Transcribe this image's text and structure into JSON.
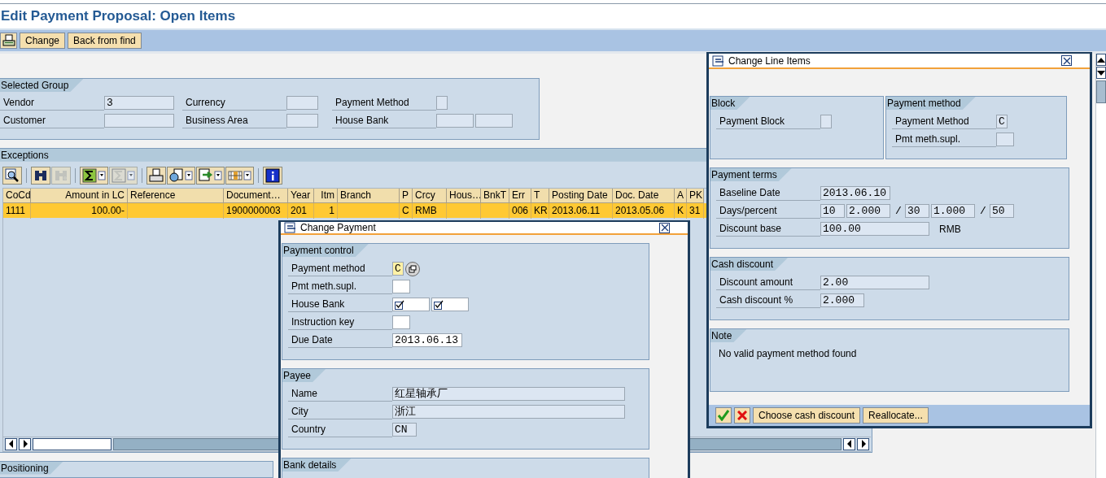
{
  "title": "Edit Payment Proposal: Open Items",
  "toolbar": {
    "buttons": [
      "Change",
      "Back from find"
    ]
  },
  "selected_group": {
    "title": "Selected Group",
    "fields": [
      {
        "label": "Vendor",
        "boxes": [
          {
            "editable": false,
            "value": "3"
          }
        ]
      },
      {
        "label": "Currency",
        "boxes": [
          {
            "editable": false
          }
        ]
      },
      {
        "label": "Payment Method",
        "boxes": [
          {
            "editable": false
          }
        ]
      },
      {
        "label": "Customer",
        "boxes": [
          {
            "editable": false
          }
        ]
      },
      {
        "label": "Business Area",
        "boxes": [
          {
            "editable": false
          }
        ]
      },
      {
        "label": "House Bank",
        "boxes": [
          {
            "editable": false
          },
          {
            "editable": false
          }
        ]
      }
    ]
  },
  "exceptions": {
    "title": "Exceptions",
    "tools": [
      {
        "kind": "details",
        "disabled": false
      },
      {
        "kind": "find",
        "disabled": false
      },
      {
        "kind": "find-next",
        "disabled": true
      },
      {
        "kind": "sum",
        "disabled": false
      },
      {
        "kind": "subtotal",
        "disabled": true
      },
      {
        "kind": "print",
        "disabled": false
      },
      {
        "kind": "view",
        "disabled": false
      },
      {
        "kind": "export",
        "disabled": false
      },
      {
        "kind": "layout",
        "disabled": false
      },
      {
        "kind": "info",
        "disabled": false
      }
    ],
    "columns": [
      "CoCd",
      "Amount in LC",
      "Reference",
      "Document…",
      "Year",
      "Itm",
      "Branch",
      "P",
      "Crcy",
      "Hous…",
      "BnkT",
      "Err",
      "T",
      "Posting Date",
      "Doc. Date",
      "A",
      "PK"
    ],
    "rows": [
      {
        "selected": true,
        "cells": [
          "1111",
          "100.00-",
          null,
          "1900000003",
          "201",
          "1",
          null,
          "C",
          "RMB",
          null,
          null,
          "006",
          "KR",
          "2013.06.11",
          "2013.05.06",
          "K",
          "31"
        ]
      }
    ]
  },
  "positioning": {
    "title": "Positioning"
  },
  "dialogs": [
    {
      "title": "Change Payment",
      "groups": [
        {
          "title": "Payment control",
          "fields": [
            {
              "label": "Payment method",
              "boxes": [
                {
                  "kind": "field",
                  "editable": true,
                  "focused": true,
                  "value": "C"
                },
                {
                  "kind": "help"
                }
              ]
            },
            {
              "label": "Pmt meth.supl.",
              "boxes": [
                {
                  "kind": "field",
                  "editable": true,
                  "focused": false
                }
              ]
            },
            {
              "label": "House Bank",
              "boxes": [
                {
                  "kind": "required",
                  "editable": true,
                  "focused": false
                },
                {
                  "kind": "required",
                  "editable": true,
                  "focused": false
                }
              ]
            },
            {
              "label": "Instruction key",
              "boxes": [
                {
                  "kind": "field",
                  "editable": true,
                  "focused": false
                }
              ]
            },
            {
              "label": "Due Date",
              "boxes": [
                {
                  "kind": "field",
                  "editable": true,
                  "focused": false,
                  "value": "2013.06.13"
                }
              ]
            }
          ]
        },
        {
          "title": "Payee",
          "fields": [
            {
              "label": "Name",
              "boxes": [
                {
                  "kind": "field",
                  "editable": false,
                  "focused": false,
                  "value": "红星轴承厂"
                }
              ]
            },
            {
              "label": "City",
              "boxes": [
                {
                  "kind": "field",
                  "editable": false,
                  "focused": false,
                  "value": "浙江"
                }
              ]
            },
            {
              "label": "Country",
              "boxes": [
                {
                  "kind": "field",
                  "editable": false,
                  "focused": false,
                  "value": "CN"
                }
              ]
            }
          ]
        },
        {
          "title": "Bank details"
        }
      ]
    },
    {
      "title": "Change Line Items",
      "groups": [
        {
          "title": "Block",
          "fields": [
            {
              "label": "Payment Block",
              "boxes": [
                {
                  "kind": "field",
                  "editable": false,
                  "focused": false
                }
              ]
            }
          ]
        },
        {
          "title": "Payment method",
          "fields": [
            {
              "label": "Payment Method",
              "boxes": [
                {
                  "kind": "field",
                  "editable": false,
                  "focused": false,
                  "value": "C"
                }
              ]
            },
            {
              "label": "Pmt meth.supl.",
              "boxes": [
                {
                  "kind": "field",
                  "editable": false,
                  "focused": false
                }
              ]
            }
          ]
        },
        {
          "title": "Payment terms",
          "fields": [
            {
              "label": "Baseline Date",
              "boxes": [
                {
                  "kind": "field",
                  "editable": false,
                  "focused": false,
                  "value": "2013.06.10"
                }
              ]
            },
            {
              "label": "Days/percent",
              "boxes": [
                {
                  "kind": "field",
                  "editable": false,
                  "focused": false,
                  "value": "10"
                },
                {
                  "kind": "field",
                  "editable": false,
                  "focused": false,
                  "value": "2.000"
                },
                {
                  "kind": "sep",
                  "value": "/"
                },
                {
                  "kind": "field",
                  "editable": false,
                  "focused": false,
                  "value": "30"
                },
                {
                  "kind": "field",
                  "editable": false,
                  "focused": false,
                  "value": "1.000"
                },
                {
                  "kind": "sep",
                  "value": "/"
                },
                {
                  "kind": "field",
                  "editable": false,
                  "focused": false,
                  "value": "50"
                }
              ]
            },
            {
              "label": "Discount base",
              "boxes": [
                {
                  "kind": "field",
                  "editable": false,
                  "focused": false,
                  "value": "100.00"
                },
                {
                  "kind": "unit",
                  "value": "RMB"
                }
              ]
            }
          ]
        },
        {
          "title": "Cash discount",
          "fields": [
            {
              "label": "Discount amount",
              "boxes": [
                {
                  "kind": "field",
                  "editable": false,
                  "focused": false,
                  "value": "2.00"
                }
              ]
            },
            {
              "label": "Cash discount %",
              "boxes": [
                {
                  "kind": "field",
                  "editable": false,
                  "focused": false,
                  "value": "2.000"
                }
              ]
            }
          ]
        },
        {
          "title": "Note",
          "text": "No valid payment method found"
        }
      ],
      "buttons": [
        {
          "kind": "ok"
        },
        {
          "kind": "cancel"
        },
        {
          "kind": "text",
          "label": "Choose cash discount"
        },
        {
          "kind": "text",
          "label": "Reallocate..."
        }
      ]
    }
  ]
}
